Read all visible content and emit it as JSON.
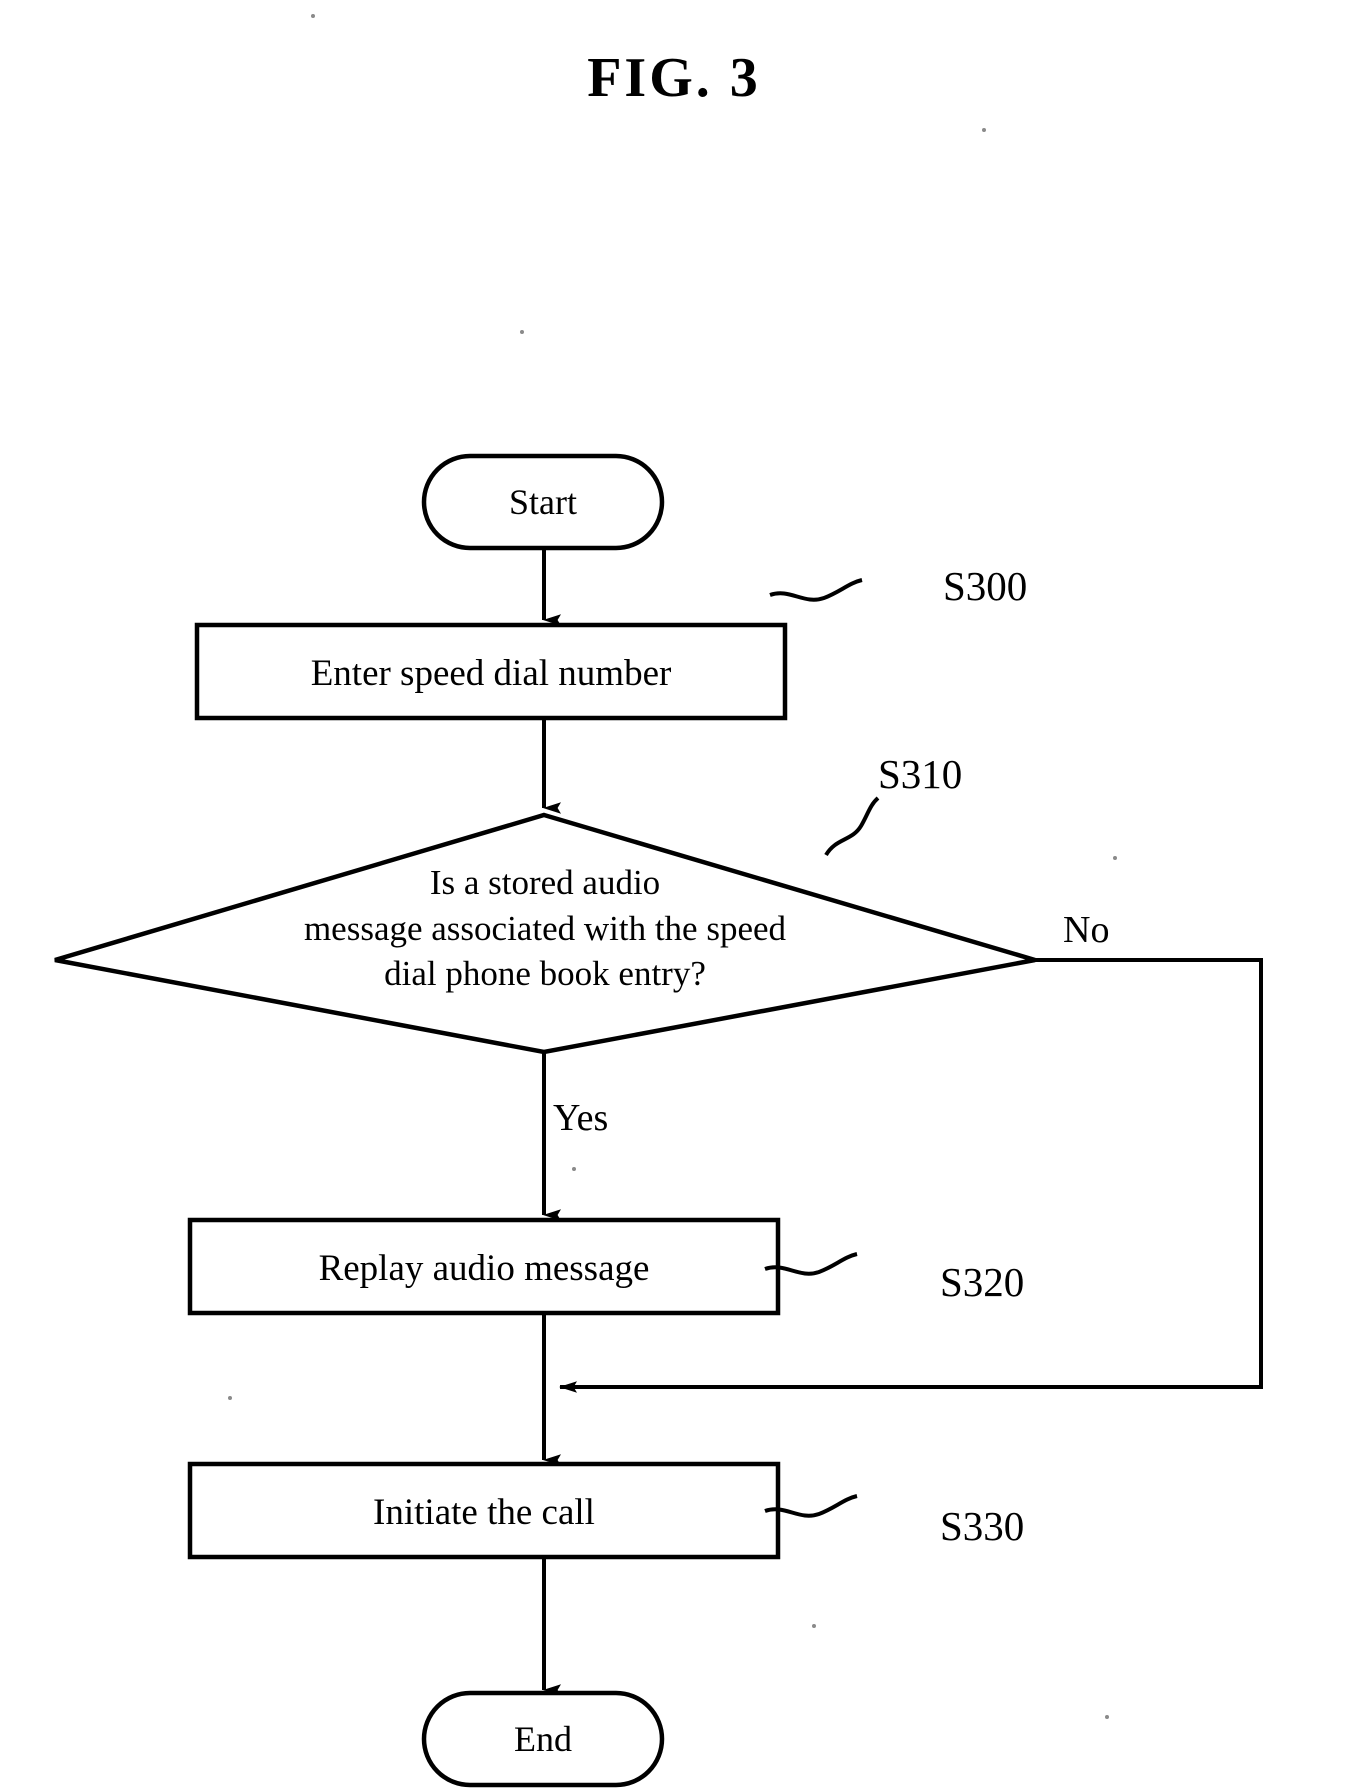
{
  "figure": {
    "title": "FIG. 3",
    "type": "flowchart",
    "ink_color": "#000000",
    "background_color": "#ffffff"
  },
  "nodes": [
    {
      "id": "start",
      "shape": "terminal",
      "label": "Start"
    },
    {
      "id": "s300",
      "shape": "process",
      "label": "Enter speed dial number",
      "ref": "S300"
    },
    {
      "id": "s310",
      "shape": "decision",
      "label": "Is a stored audio message associated with the speed dial phone book entry?",
      "line1": "Is a stored audio",
      "line2": "message associated with the speed",
      "line3": "dial phone book entry?",
      "ref": "S310"
    },
    {
      "id": "s320",
      "shape": "process",
      "label": "Replay audio message",
      "ref": "S320"
    },
    {
      "id": "s330",
      "shape": "process",
      "label": "Initiate the call",
      "ref": "S330"
    },
    {
      "id": "end",
      "shape": "terminal",
      "label": "End"
    }
  ],
  "branch_labels": {
    "yes": "Yes",
    "no": "No"
  },
  "edges": [
    {
      "from": "start",
      "to": "s300",
      "label": ""
    },
    {
      "from": "s300",
      "to": "s310",
      "label": ""
    },
    {
      "from": "s310",
      "to": "s320",
      "label": "Yes"
    },
    {
      "from": "s310",
      "to": "s330",
      "label": "No"
    },
    {
      "from": "s320",
      "to": "s330",
      "label": ""
    },
    {
      "from": "s330",
      "to": "end",
      "label": ""
    }
  ],
  "reference_numerals": [
    "S300",
    "S310",
    "S320",
    "S330"
  ]
}
